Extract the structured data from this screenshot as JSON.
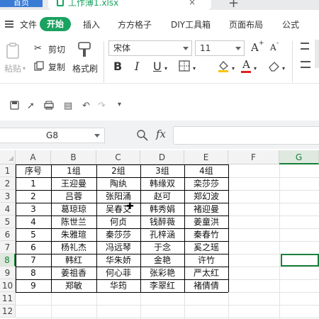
{
  "titlebar": {
    "home_tab": "首页",
    "file_tab": "工作薄1.xlsx",
    "close_icon": "×",
    "add_icon": "+"
  },
  "menu": {
    "file": "文件",
    "active": "开始",
    "items": [
      "插入",
      "方方格子",
      "DIY工具箱",
      "页面布局",
      "公式"
    ]
  },
  "toolbar": {
    "paste": "粘贴",
    "cut": "剪切",
    "copy": "复制",
    "format_painter": "格式刷",
    "font_name": "宋体",
    "font_size": "11",
    "bold": "B",
    "italic": "I",
    "underline": "U",
    "grow_font": "A",
    "shrink_font": "A"
  },
  "formula_bar": {
    "name_box": "G8",
    "fx": "fx",
    "value": ""
  },
  "grid": {
    "columns": [
      "A",
      "B",
      "C",
      "D",
      "E",
      "F",
      "G"
    ],
    "selected_column": "G",
    "rows": [
      "1",
      "2",
      "3",
      "4",
      "5",
      "6",
      "7",
      "8",
      "9",
      "10",
      "11",
      "12"
    ],
    "selected_row": "8",
    "table": [
      [
        "序号",
        "1组",
        "2组",
        "3组",
        "4组"
      ],
      [
        "1",
        "王迎曼",
        "陶纨",
        "韩缘双",
        "栾莎莎"
      ],
      [
        "2",
        "吕蓉",
        "张阳涌",
        "赵可",
        "郑幻波"
      ],
      [
        "3",
        "葛琼琼",
        "吴春艾",
        "韩秀娟",
        "褚迎曼"
      ],
      [
        "4",
        "陈世兰",
        "何贞",
        "钱醉薇",
        "姜童洪"
      ],
      [
        "5",
        "朱雅瑄",
        "秦莎莎",
        "孔梓涵",
        "秦春竹"
      ],
      [
        "6",
        "杨礼杰",
        "冯远琴",
        "于念",
        "奚之瑶"
      ],
      [
        "7",
        "韩红",
        "华朱娇",
        "金艳",
        "许竹"
      ],
      [
        "8",
        "姜祖香",
        "何心菲",
        "张彩艳",
        "严太红"
      ],
      [
        "9",
        "郑敏",
        "华筠",
        "李翠红",
        "褚倩倩"
      ]
    ]
  },
  "accent_color": "#1aa260",
  "selection_color": "#1a7f3c"
}
